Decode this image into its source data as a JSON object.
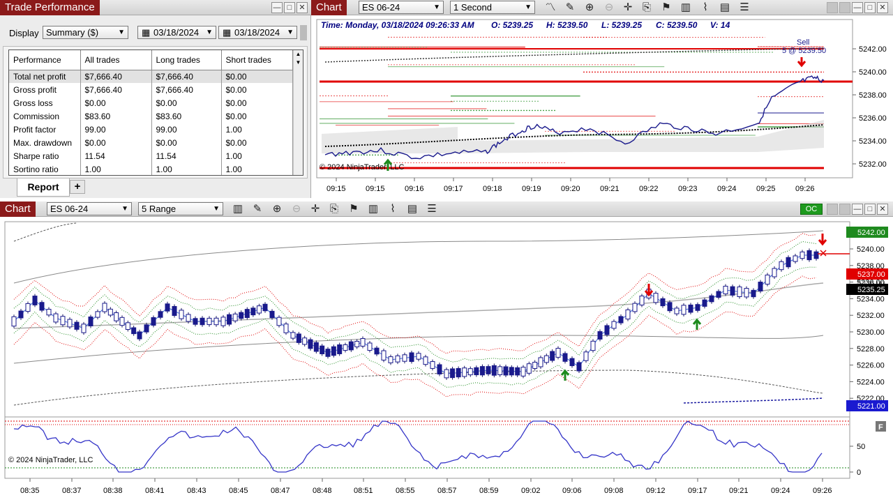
{
  "trade_performance": {
    "title": "Trade Performance",
    "display_label": "Display",
    "display_value": "Summary ($)",
    "date_from": "03/18/2024",
    "date_to": "03/18/2024",
    "columns": [
      "Performance",
      "All trades",
      "Long trades",
      "Short trades"
    ],
    "rows": [
      [
        "Total net profit",
        "$7,666.40",
        "$7,666.40",
        "$0.00"
      ],
      [
        "Gross profit",
        "$7,666.40",
        "$7,666.40",
        "$0.00"
      ],
      [
        "Gross loss",
        "$0.00",
        "$0.00",
        "$0.00"
      ],
      [
        "Commission",
        "$83.60",
        "$83.60",
        "$0.00"
      ],
      [
        "Profit factor",
        "99.00",
        "99.00",
        "1.00"
      ],
      [
        "Max. drawdown",
        "$0.00",
        "$0.00",
        "$0.00"
      ],
      [
        "Sharpe ratio",
        "11.54",
        "11.54",
        "1.00"
      ],
      [
        "Sortino ratio",
        "1.00",
        "1.00",
        "1.00"
      ]
    ],
    "tab_label": "Report",
    "tab_add": "+"
  },
  "chart1": {
    "title": "Chart",
    "instrument": "ES 06-24",
    "interval": "1 Second",
    "info": {
      "time": "Time: Monday, 03/18/2024 09:26:33 AM",
      "open": "O: 5239.25",
      "high": "H: 5239.50",
      "low": "L: 5239.25",
      "close": "C: 5239.50",
      "volume": "V: 14"
    },
    "annotation_sell": "Sell",
    "annotation_price": "5 @ 5239.50",
    "copyright": "© 2024 NinjaTrader, LLC",
    "y_ticks": [
      "5242.00",
      "5240.00",
      "5238.00",
      "5236.00",
      "5234.00",
      "5232.00"
    ],
    "x_ticks": [
      "09:15",
      "09:15",
      "09:16",
      "09:17",
      "09:18",
      "09:19",
      "09:20",
      "09:21",
      "09:22",
      "09:23",
      "09:24",
      "09:25",
      "09:26"
    ]
  },
  "chart2": {
    "title": "Chart",
    "instrument": "ES 06-24",
    "interval": "5 Range",
    "oc_label": "OC",
    "f_label": "F",
    "copyright": "© 2024 NinjaTrader, LLC",
    "y_ticks": [
      "5240.00",
      "5238.00",
      "5236.00",
      "5234.00",
      "5232.00",
      "5230.00",
      "5228.00",
      "5226.00",
      "5224.00",
      "5222.00"
    ],
    "price_tags": {
      "top": "5242.00",
      "red": "5237.00",
      "black": "5235.25",
      "blue": "5221.00",
      "gray": "5236.00"
    },
    "osc_ticks": [
      "50",
      "0"
    ],
    "x_ticks": [
      "08:35",
      "08:37",
      "08:38",
      "08:41",
      "08:43",
      "08:45",
      "08:47",
      "08:48",
      "08:51",
      "08:55",
      "08:57",
      "08:59",
      "09:02",
      "09:06",
      "09:08",
      "09:12",
      "09:17",
      "09:21",
      "09:24",
      "09:26"
    ]
  },
  "colors": {
    "title_red": "#8b1a1a",
    "price_red": "#e00000",
    "price_green": "#1e8a1e",
    "price_blue": "#1a1aa0",
    "osc_blue": "#3535c8"
  }
}
